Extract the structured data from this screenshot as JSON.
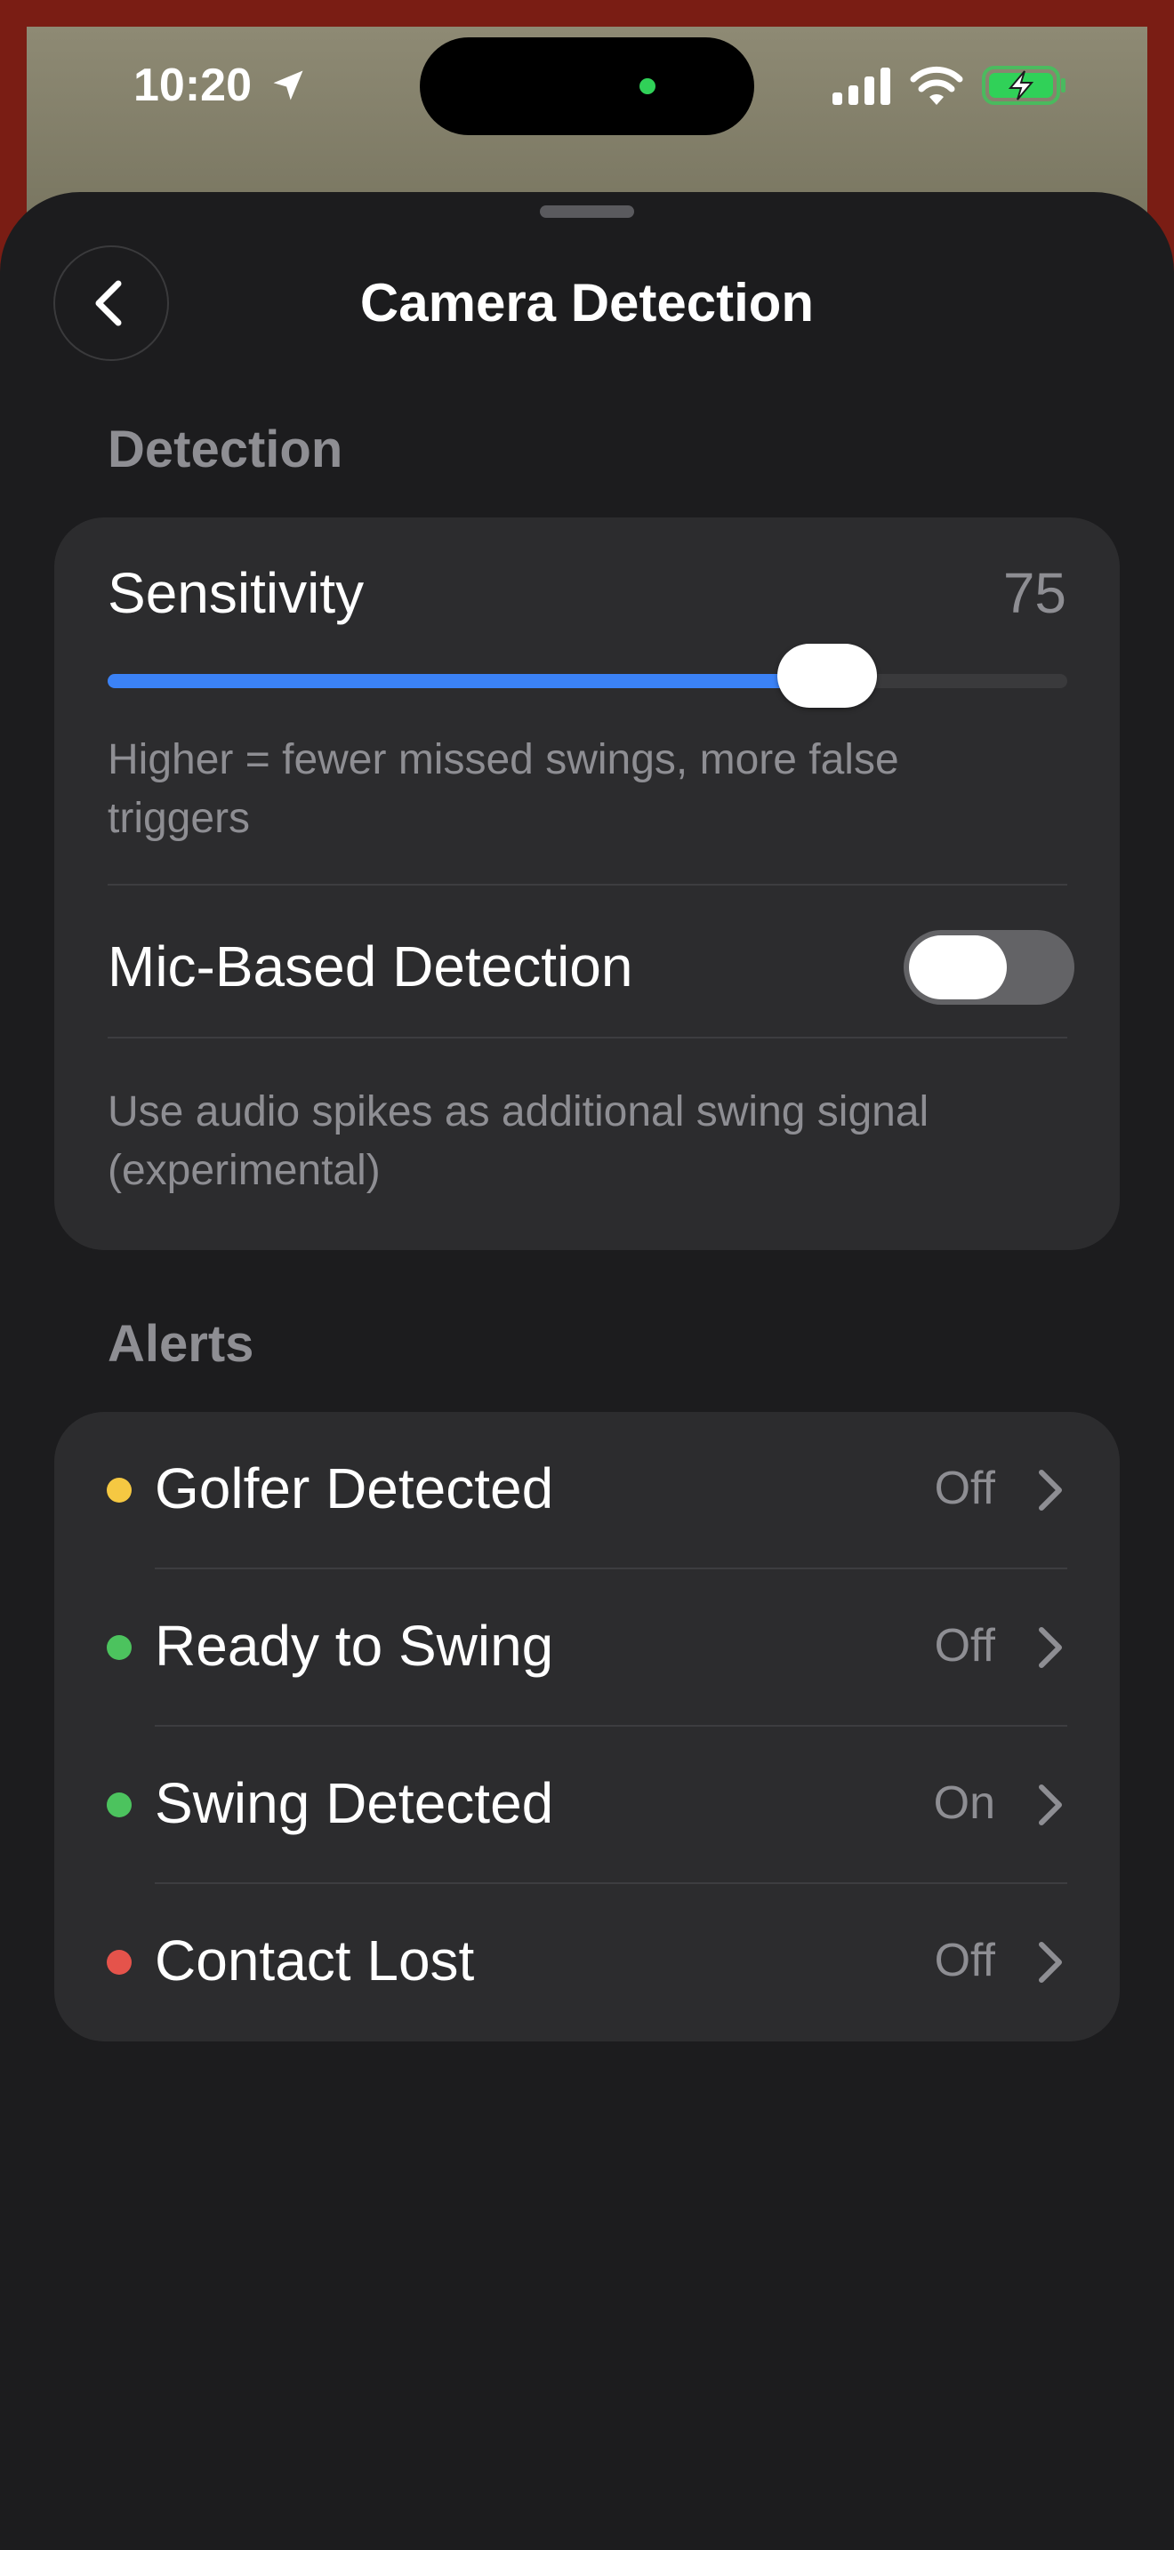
{
  "status_bar": {
    "time": "10:20",
    "icons": [
      "location-arrow-icon",
      "cellular-signal-icon",
      "wifi-icon",
      "battery-charging-icon"
    ]
  },
  "header": {
    "title": "Camera Detection",
    "back_icon": "chevron-left-icon"
  },
  "detection": {
    "section_title": "Detection",
    "sensitivity": {
      "label": "Sensitivity",
      "value": "75",
      "slider_fraction": 0.75,
      "hint": "Higher = fewer missed swings, more false triggers"
    },
    "mic": {
      "label": "Mic-Based Detection",
      "enabled": false,
      "hint": "Use audio spikes as additional swing signal (experimental)"
    }
  },
  "alerts": {
    "section_title": "Alerts",
    "items": [
      {
        "label": "Golfer Detected",
        "status": "Off",
        "dot_color": "#f5c842"
      },
      {
        "label": "Ready to Swing",
        "status": "Off",
        "dot_color": "#4cc35e"
      },
      {
        "label": "Swing Detected",
        "status": "On",
        "dot_color": "#4cc35e"
      },
      {
        "label": "Contact Lost",
        "status": "Off",
        "dot_color": "#e5534b"
      }
    ]
  },
  "colors": {
    "accent": "#3b82f6",
    "sheet_background": "#1c1c1e",
    "card_background": "#2c2c2e",
    "secondary_text": "#8e8e93"
  }
}
